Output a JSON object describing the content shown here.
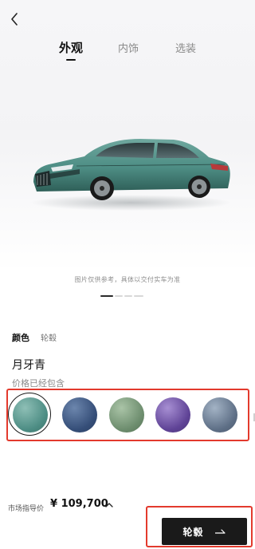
{
  "header": {
    "back_icon": "chevron-left-icon",
    "tabs": [
      {
        "label": "外观",
        "active": true
      },
      {
        "label": "内饰",
        "active": false
      },
      {
        "label": "选装",
        "active": false
      }
    ]
  },
  "gallery": {
    "car_color": "#4d8d84",
    "disclaimer": "图片仅供参考，具体以交付实车为准",
    "pager": {
      "current": 1,
      "total": 4
    }
  },
  "options": {
    "tabs": [
      {
        "label": "颜色",
        "active": true
      },
      {
        "label": "轮毂",
        "active": false
      }
    ],
    "selected_color_name": "月牙青",
    "price_note": "价格已经包含",
    "swatches": [
      {
        "name": "teal",
        "color": "#4d8d84",
        "selected": true
      },
      {
        "name": "navy-blue",
        "color": "#354e78",
        "selected": false
      },
      {
        "name": "sage-green",
        "color": "#6d8d6e",
        "selected": false
      },
      {
        "name": "purple",
        "color": "#5f4396",
        "selected": false
      },
      {
        "name": "slate-blue-gray",
        "color": "#5e6f86",
        "selected": false
      }
    ]
  },
  "footer": {
    "price_label": "市场指导价",
    "price_value": "¥ 109,700",
    "expand_icon": "chevron-up-icon",
    "cta_label": "轮毂",
    "cta_icon": "arrow-right-icon"
  },
  "colors": {
    "highlight": "#e33a2d",
    "cta_bg": "#1a1a1a"
  }
}
